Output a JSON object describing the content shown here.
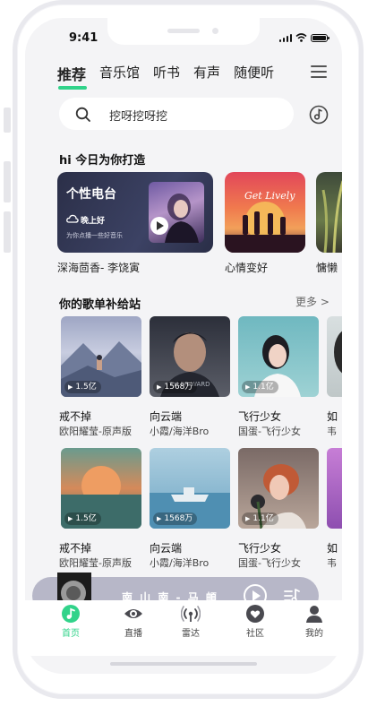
{
  "status_bar": {
    "time": "9:41"
  },
  "tabs": [
    {
      "label": "推荐",
      "active": true
    },
    {
      "label": "音乐馆"
    },
    {
      "label": "听书"
    },
    {
      "label": "有声"
    },
    {
      "label": "随便听"
    }
  ],
  "search": {
    "text": "挖呀挖呀挖"
  },
  "daily": {
    "title": "hi 今日为你打造",
    "radio": {
      "title": "个性电台",
      "sub": "晚上好",
      "sub2": "为你点播一些好音乐"
    },
    "cards": [
      {
        "caption": "深海茴香- 李饶寅"
      },
      {
        "caption": "心情变好"
      },
      {
        "caption": "慵懒"
      }
    ]
  },
  "playlist": {
    "title": "你的歌单补给站",
    "more": "更多 >",
    "rows": [
      [
        {
          "title": "戒不掉",
          "artist": "欧阳耀莹-原声版",
          "plays": "1.5亿"
        },
        {
          "title": "向云端",
          "artist": "小霞/海洋Bro",
          "plays": "1568万"
        },
        {
          "title": "飞行少女",
          "artist": "国蛋-飞行少女",
          "plays": "1.1亿"
        },
        {
          "title": "如",
          "artist": "韦",
          "plays": ""
        }
      ],
      [
        {
          "title": "戒不掉",
          "artist": "欧阳耀莹-原声版",
          "plays": "1.5亿"
        },
        {
          "title": "向云端",
          "artist": "小霞/海洋Bro",
          "plays": "1568万"
        },
        {
          "title": "飞行少女",
          "artist": "国蛋-飞行少女",
          "plays": "1.1亿"
        },
        {
          "title": "如",
          "artist": "韦",
          "plays": ""
        }
      ]
    ]
  },
  "player": {
    "title": "南 山 南 - 马 頔"
  },
  "nav": [
    {
      "label": "首页",
      "icon": "music-note-icon",
      "active": true
    },
    {
      "label": "直播",
      "icon": "eye-icon"
    },
    {
      "label": "雷达",
      "icon": "radar-icon"
    },
    {
      "label": "社区",
      "icon": "heart-icon"
    },
    {
      "label": "我的",
      "icon": "user-icon"
    }
  ],
  "colors": {
    "accent": "#31d38a",
    "player_bar": "#b7b7c8"
  }
}
